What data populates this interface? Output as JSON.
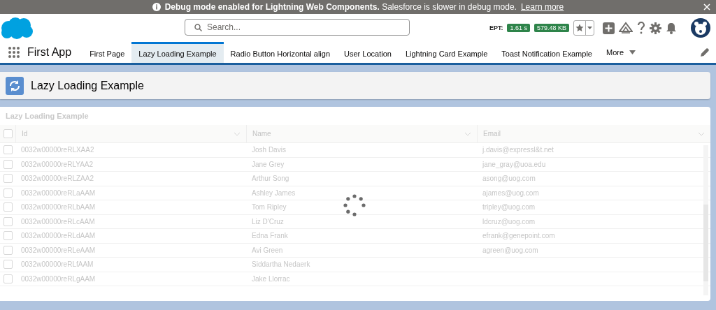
{
  "banner": {
    "bold_text": "Debug mode enabled for Lightning Web Components.",
    "text": "Salesforce is slower in debug mode.",
    "link": "Learn more"
  },
  "header": {
    "search": {
      "placeholder": "Search..."
    },
    "ept_label": "EPT:",
    "ept_time": "1.61 s",
    "ept_size": "579.48 KB"
  },
  "nav": {
    "app_name": "First App",
    "tabs": [
      {
        "label": "First Page",
        "selected": false
      },
      {
        "label": "Lazy Loading Example",
        "selected": true
      },
      {
        "label": "Radio Button Horizontal align",
        "selected": false
      },
      {
        "label": "User Location",
        "selected": false
      },
      {
        "label": "Lightning Card Example",
        "selected": false
      },
      {
        "label": "Toast Notification Example",
        "selected": false
      }
    ],
    "more": "More"
  },
  "page_header": {
    "title": "Lazy Loading Example"
  },
  "card": {
    "title": "Lazy Loading Example",
    "loading": true,
    "select_all_checked": false,
    "columns": [
      "Id",
      "Name",
      "Email"
    ],
    "rows": [
      {
        "id": "0032w00000reRLXAA2",
        "name": "Josh Davis",
        "email": "j.davis@expressl&t.net",
        "checked": false
      },
      {
        "id": "0032w00000reRLYAA2",
        "name": "Jane Grey",
        "email": "jane_gray@uoa.edu",
        "checked": false
      },
      {
        "id": "0032w00000reRLZAA2",
        "name": "Arthur Song",
        "email": "asong@uog.com",
        "checked": false
      },
      {
        "id": "0032w00000reRLaAAM",
        "name": "Ashley James",
        "email": "ajames@uog.com",
        "checked": false
      },
      {
        "id": "0032w00000reRLbAAM",
        "name": "Tom Ripley",
        "email": "tripley@uog.com",
        "checked": false
      },
      {
        "id": "0032w00000reRLcAAM",
        "name": "Liz D'Cruz",
        "email": "ldcruz@uog.com",
        "checked": false
      },
      {
        "id": "0032w00000reRLdAAM",
        "name": "Edna Frank",
        "email": "efrank@genepoint.com",
        "checked": false
      },
      {
        "id": "0032w00000reRLeAAM",
        "name": "Avi Green",
        "email": "agreen@uog.com",
        "checked": false
      },
      {
        "id": "0032w00000reRLfAAM",
        "name": "Siddartha Nedaerk",
        "email": "",
        "checked": false
      },
      {
        "id": "0032w00000reRLgAAM",
        "name": "Jake Llorrac",
        "email": "",
        "checked": false
      }
    ]
  }
}
